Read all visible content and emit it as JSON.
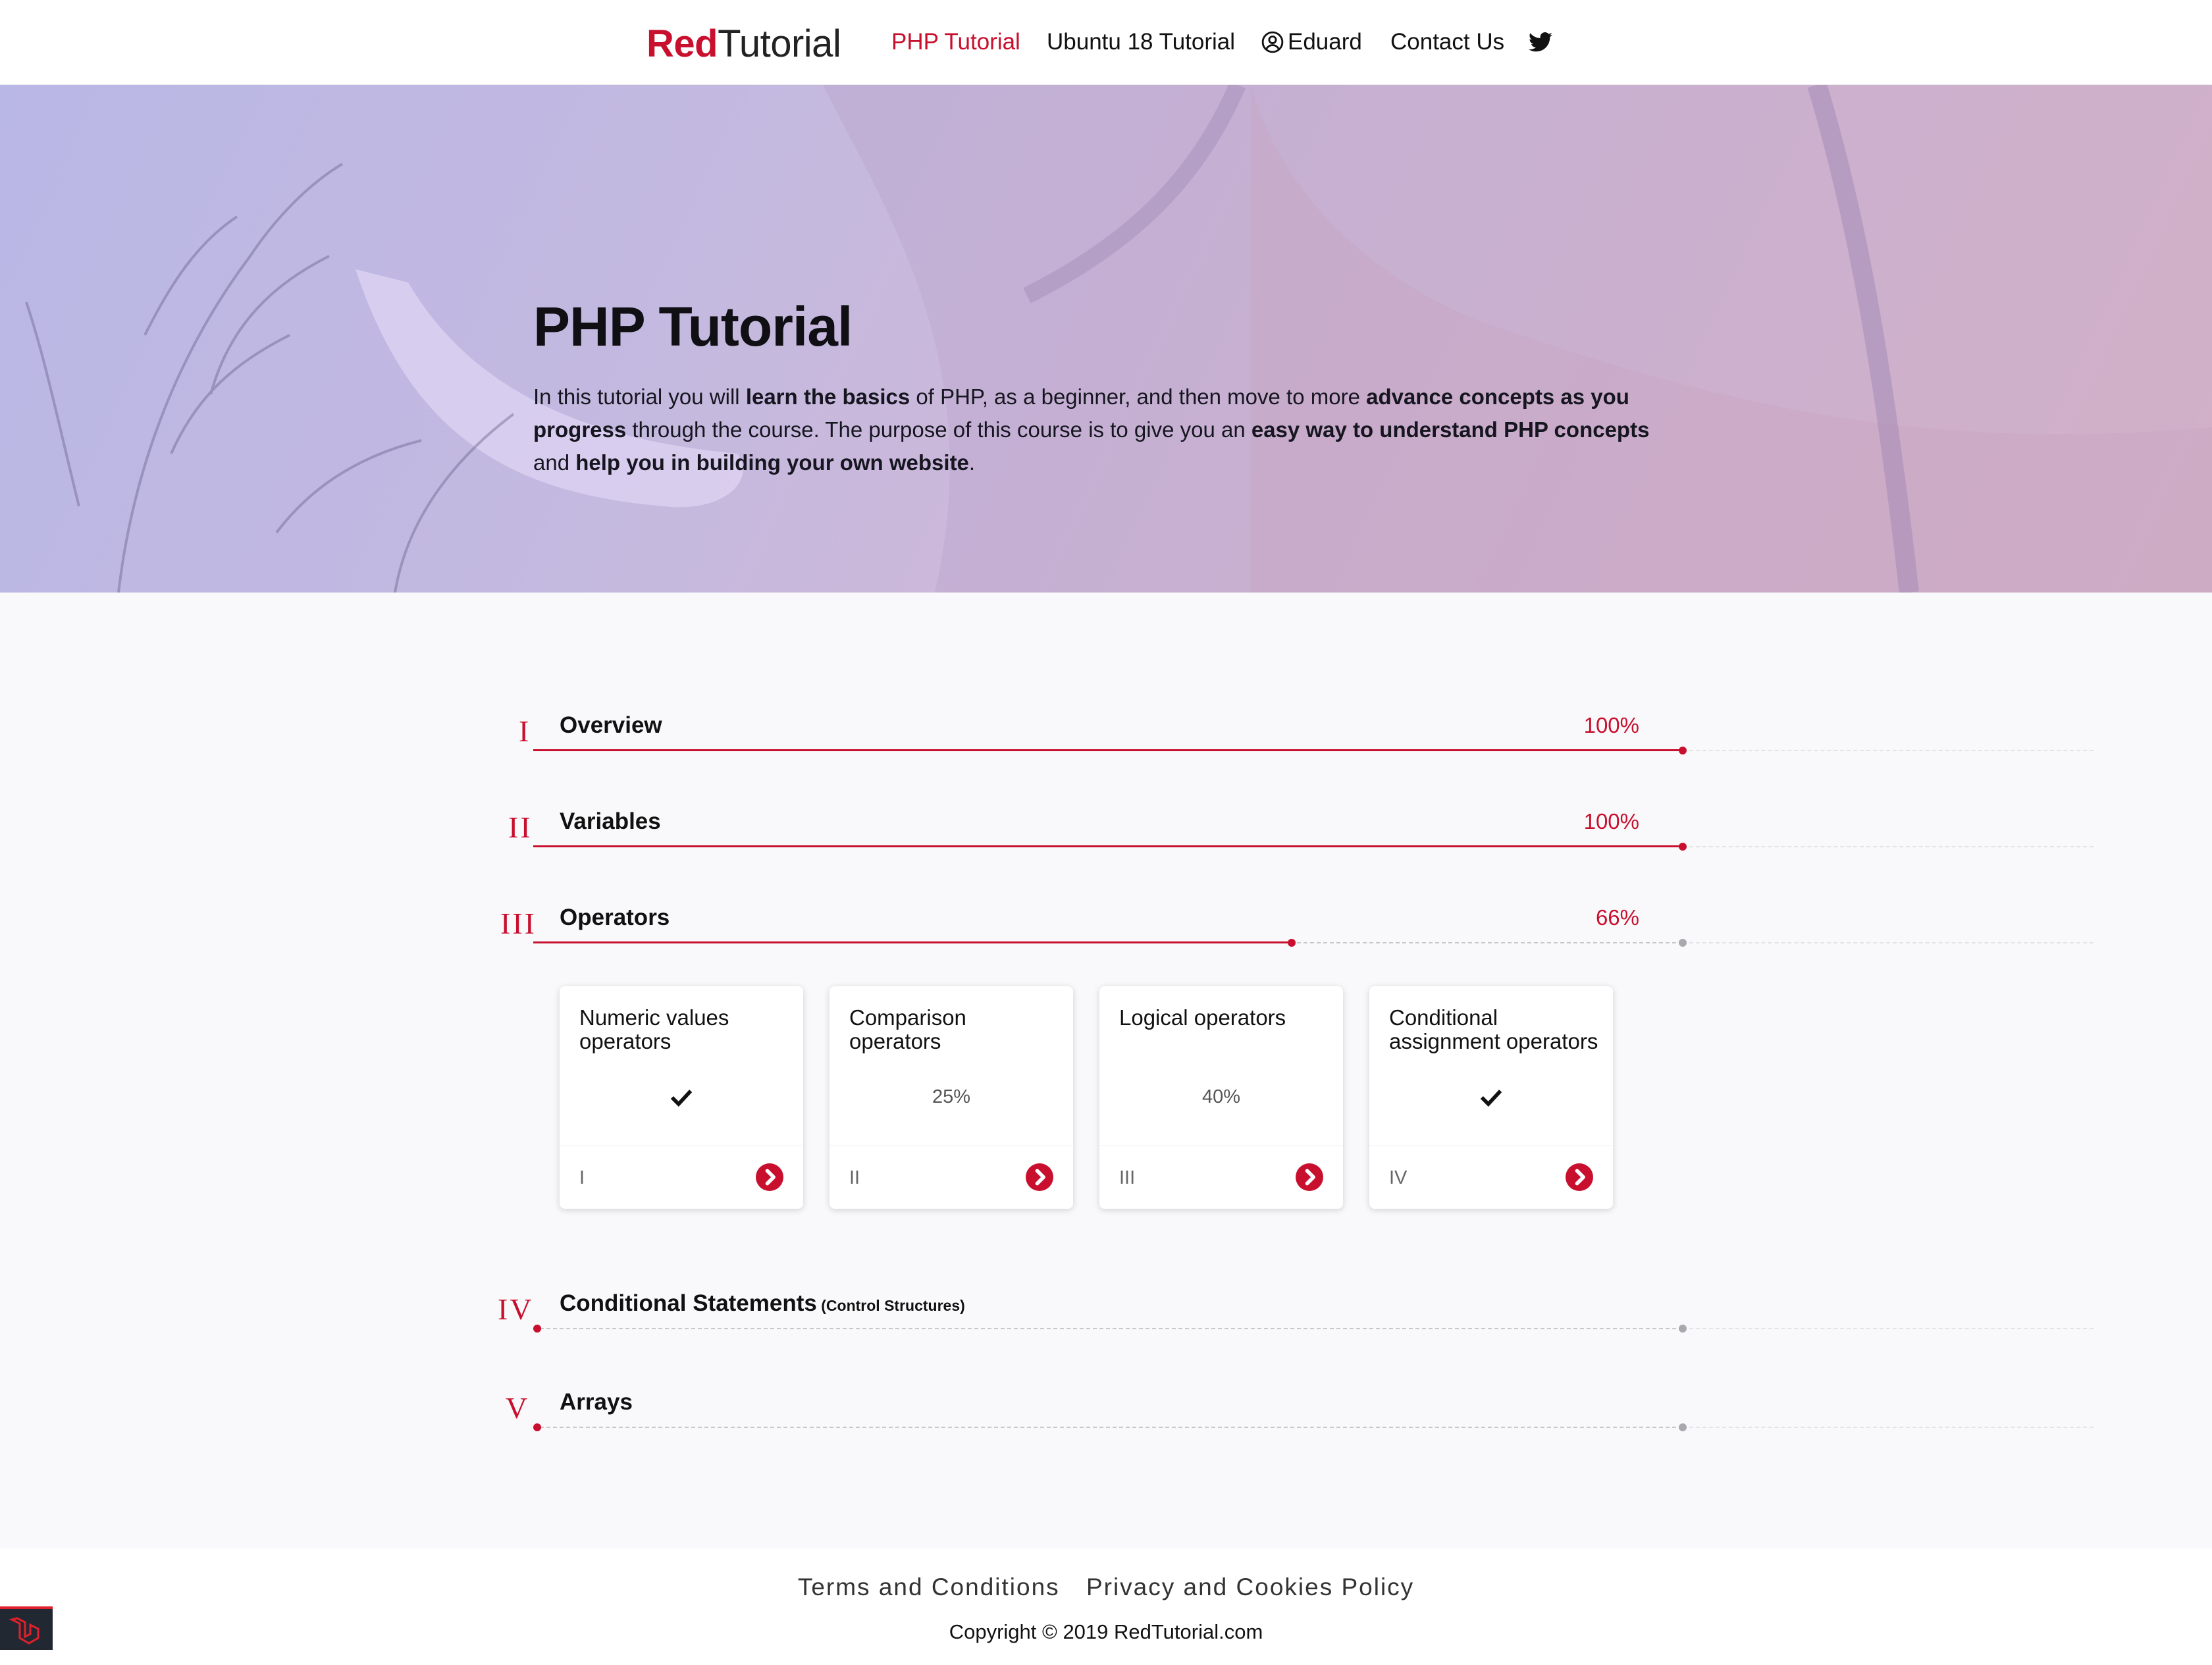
{
  "nav": {
    "logo_red": "Red",
    "logo_rest": "Tutorial",
    "links": [
      "PHP Tutorial",
      "Ubuntu 18 Tutorial",
      "Eduard",
      "Contact Us"
    ],
    "twitter_icon": "twitter-icon",
    "user_icon": "user-circle-icon"
  },
  "hero": {
    "title": "PHP Tutorial",
    "text": [
      {
        "t": "In this tutorial you will ",
        "b": false
      },
      {
        "t": "learn the basics",
        "b": true
      },
      {
        "t": " of PHP, as a beginner, and then move to more ",
        "b": false
      },
      {
        "t": "advance concepts as you progress",
        "b": true
      },
      {
        "t": " through the course. The purpose of this course is to give you an ",
        "b": false
      },
      {
        "t": "easy way to understand PHP concepts",
        "b": true
      },
      {
        "t": " and ",
        "b": false
      },
      {
        "t": "help you  in building your own website",
        "b": true
      },
      {
        "t": ".",
        "b": false
      }
    ]
  },
  "sections": [
    {
      "roman": "I",
      "title": "Overview",
      "subtitle": "",
      "progress_text": "100%",
      "progress": 1.0
    },
    {
      "roman": "II",
      "title": "Variables",
      "subtitle": "",
      "progress_text": "100%",
      "progress": 1.0
    },
    {
      "roman": "III",
      "title": "Operators",
      "subtitle": "",
      "progress_text": "66%",
      "progress": 0.66
    },
    {
      "roman": "IV",
      "title": "Conditional Statements",
      "subtitle": "(Control Structures)",
      "progress_text": "",
      "progress": 0
    },
    {
      "roman": "V",
      "title": "Arrays",
      "subtitle": "",
      "progress_text": "",
      "progress": 0
    }
  ],
  "cards": [
    {
      "title": "Numeric values operators",
      "status": "",
      "done": true,
      "roman": "I"
    },
    {
      "title": "Comparison operators",
      "status": "25%",
      "done": false,
      "roman": "II"
    },
    {
      "title": "Logical operators",
      "status": "40%",
      "done": false,
      "roman": "III"
    },
    {
      "title": "Conditional assignment operators",
      "status": "",
      "done": true,
      "roman": "IV"
    }
  ],
  "footer": {
    "links": [
      "Terms and Conditions",
      "Privacy and Cookies Policy"
    ],
    "copyright": "Copyright © 2019 RedTutorial.com"
  },
  "colors": {
    "accent": "#c8102e",
    "hero_from": "#b9b7e6",
    "hero_to": "#e0b9c7"
  }
}
